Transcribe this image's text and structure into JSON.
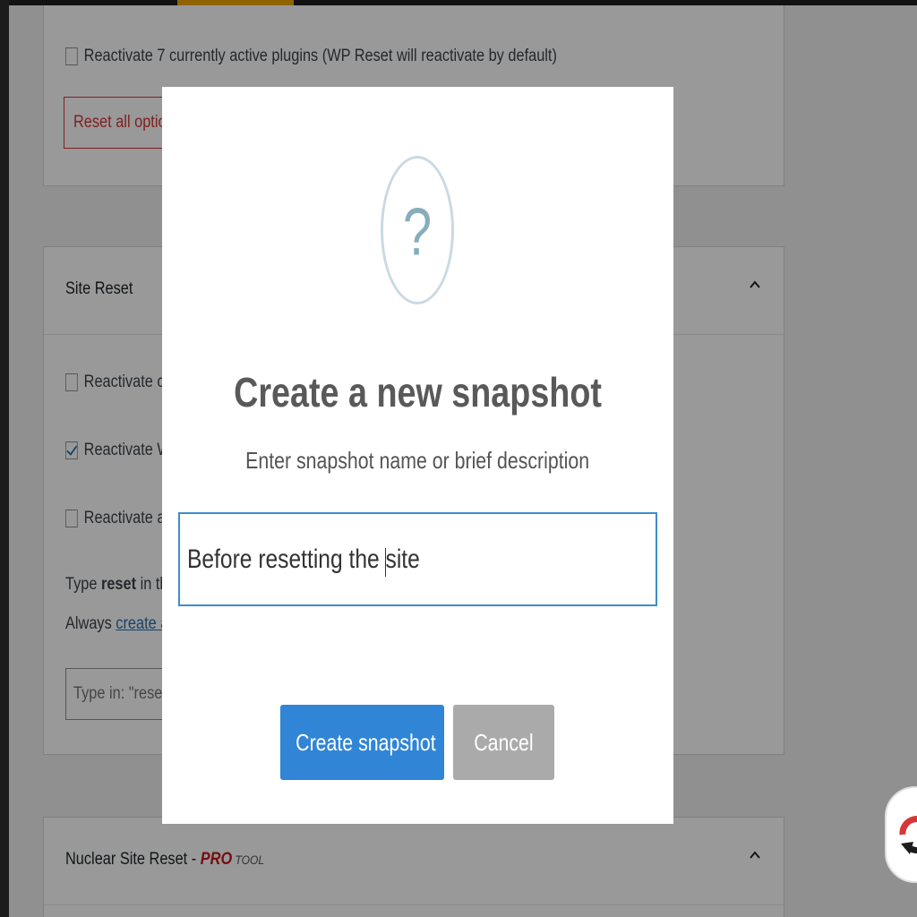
{
  "top_card": {
    "reactivate_plugins_label": "Reactivate 7 currently active plugins (WP Reset will reactivate by default)",
    "reset_button_label": "Reset all options -"
  },
  "site_reset": {
    "title": "Site Reset",
    "options": [
      {
        "label": "Reactivate curr",
        "checked": false
      },
      {
        "label": "Reactivate WP",
        "checked": true
      },
      {
        "label": "Reactivate all c",
        "checked": false
      }
    ],
    "type_prefix": "Type ",
    "type_keyword": "reset",
    "type_suffix": " in the c",
    "always_prefix": "Always ",
    "always_link": "create a sn",
    "confirm_placeholder": "Type in: \"reset\""
  },
  "nuclear_reset": {
    "title": "Nuclear Site Reset - ",
    "pro": "PRO",
    "tool": " TOOL"
  },
  "modal": {
    "icon": "question-mark-icon",
    "icon_glyph": "?",
    "title": "Create a new snapshot",
    "subtitle": "Enter snapshot name or brief description",
    "input_value": "Before resetting the site",
    "confirm_label": "Create snapshot",
    "cancel_label": "Cancel"
  },
  "colors": {
    "primary_button": "#3085d6",
    "cancel_button": "#aaaaaa",
    "danger": "#d63638",
    "link": "#2271b1",
    "accent": "#f0a500"
  }
}
